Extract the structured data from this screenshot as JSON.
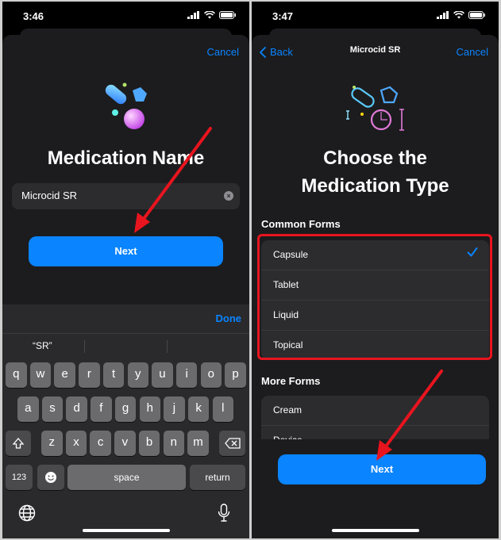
{
  "left": {
    "status": {
      "time": "3:46"
    },
    "cancel_label": "Cancel",
    "heading": "Medication Name",
    "field_value": "Microcid SR",
    "next_label": "Next",
    "done_label": "Done",
    "suggestion": "“SR”",
    "rows": [
      [
        "q",
        "w",
        "e",
        "r",
        "t",
        "y",
        "u",
        "i",
        "o",
        "p"
      ],
      [
        "a",
        "s",
        "d",
        "f",
        "g",
        "h",
        "j",
        "k",
        "l"
      ],
      [
        "z",
        "x",
        "c",
        "v",
        "b",
        "n",
        "m"
      ]
    ],
    "num_key": "123",
    "space_key": "space",
    "return_key": "return"
  },
  "right": {
    "status": {
      "time": "3:47"
    },
    "back_label": "Back",
    "nav_title": "Microcid SR",
    "cancel_label": "Cancel",
    "heading_line1": "Choose the",
    "heading_line2": "Medication Type",
    "common_label": "Common Forms",
    "common_forms": [
      "Capsule",
      "Tablet",
      "Liquid",
      "Topical"
    ],
    "selected": "Capsule",
    "more_label": "More Forms",
    "more_forms": [
      "Cream",
      "Device"
    ],
    "next_label": "Next"
  },
  "colors": {
    "accent": "#0a84ff",
    "highlight": "#e8141e",
    "arrow": "#e8141e"
  }
}
